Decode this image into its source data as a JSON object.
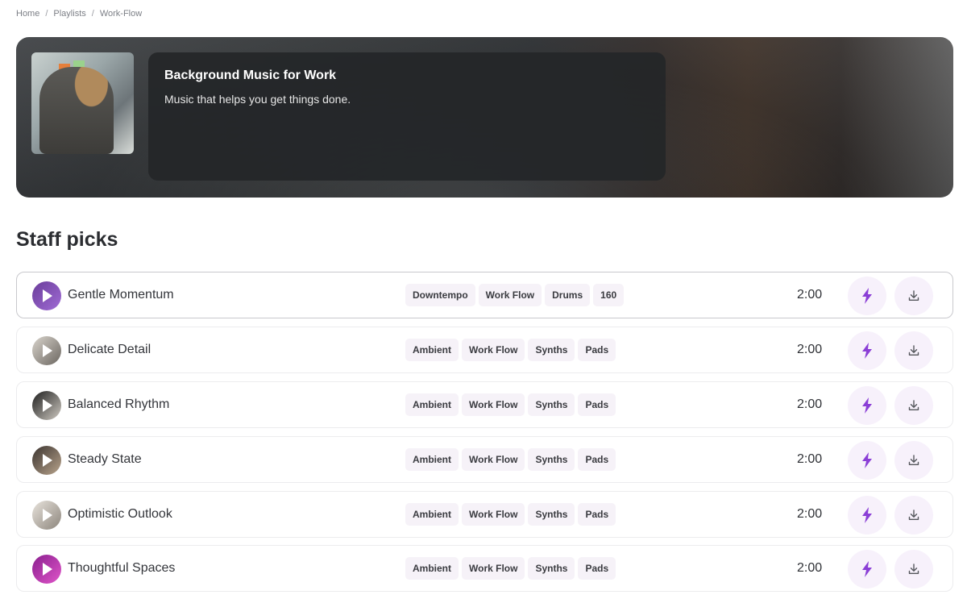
{
  "breadcrumb": {
    "items": [
      "Home",
      "Playlists",
      "Work-Flow"
    ],
    "separator": "/"
  },
  "hero": {
    "title": "Background Music for Work",
    "subtitle": "Music that helps you get things done."
  },
  "section": {
    "title": "Staff picks"
  },
  "colors": {
    "accent": "#8b3fd6",
    "tag_bg": "#f6f2f8",
    "button_bg": "#f7f1fb"
  },
  "tracks": [
    {
      "title": "Gentle Momentum",
      "tags": [
        "Downtempo",
        "Work Flow",
        "Drums",
        "160"
      ],
      "duration": "2:00",
      "active": true,
      "thumb": [
        "#6a3d9a",
        "#a06cd5"
      ]
    },
    {
      "title": "Delicate Detail",
      "tags": [
        "Ambient",
        "Work Flow",
        "Synths",
        "Pads"
      ],
      "duration": "2:00",
      "active": false,
      "thumb": [
        "#d9d4cc",
        "#6b6660"
      ]
    },
    {
      "title": "Balanced Rhythm",
      "tags": [
        "Ambient",
        "Work Flow",
        "Synths",
        "Pads"
      ],
      "duration": "2:00",
      "active": false,
      "thumb": [
        "#1e1e1e",
        "#cfcac2"
      ]
    },
    {
      "title": "Steady State",
      "tags": [
        "Ambient",
        "Work Flow",
        "Synths",
        "Pads"
      ],
      "duration": "2:00",
      "active": false,
      "thumb": [
        "#3b3430",
        "#b9a48c"
      ]
    },
    {
      "title": "Optimistic Outlook",
      "tags": [
        "Ambient",
        "Work Flow",
        "Synths",
        "Pads"
      ],
      "duration": "2:00",
      "active": false,
      "thumb": [
        "#e8e3dc",
        "#8c857c"
      ]
    },
    {
      "title": "Thoughtful Spaces",
      "tags": [
        "Ambient",
        "Work Flow",
        "Synths",
        "Pads"
      ],
      "duration": "2:00",
      "active": false,
      "thumb": [
        "#8a1f8f",
        "#e055c9"
      ]
    }
  ],
  "icons": {
    "boost": "lightning-icon",
    "download": "download-icon",
    "play": "play-icon"
  }
}
